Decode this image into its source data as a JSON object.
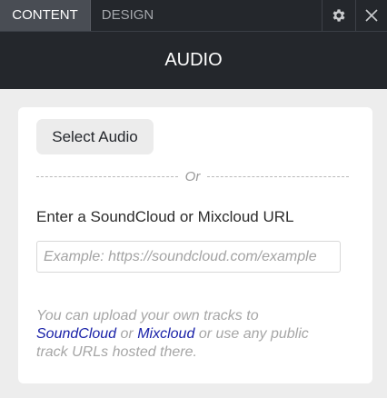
{
  "tabs": {
    "content_label": "CONTENT",
    "design_label": "DESIGN"
  },
  "icons": {
    "settings": "gear-icon",
    "close": "close-icon"
  },
  "header": {
    "title": "AUDIO"
  },
  "panel": {
    "select_button_label": "Select Audio",
    "or_separator": "Or",
    "url_label": "Enter a SoundCloud or Mixcloud URL",
    "url_placeholder": "Example: https://soundcloud.com/example",
    "url_value": "",
    "help_text_1": "You can upload your own tracks to",
    "help_link_soundcloud": "SoundCloud",
    "help_text_2": "or",
    "help_link_mixcloud": "Mixcloud",
    "help_text_3": "or use any public track URLs hosted there."
  },
  "colors": {
    "topbar_bg": "#24272c",
    "active_tab_bg": "#494d54",
    "page_bg": "#ededed",
    "link": "#1a22a8"
  }
}
